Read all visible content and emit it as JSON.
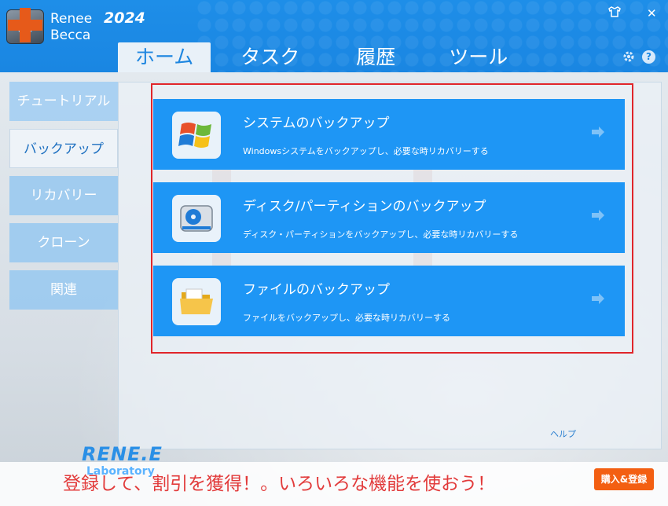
{
  "app": {
    "name_line1": "Renee",
    "name_line2": "Becca",
    "year": "2024"
  },
  "window_controls": {
    "skin_icon": "tshirt-icon",
    "close_label": "✕"
  },
  "tabs": [
    {
      "label": "ホーム",
      "active": true
    },
    {
      "label": "タスク",
      "active": false
    },
    {
      "label": "履歴",
      "active": false
    },
    {
      "label": "ツール",
      "active": false
    }
  ],
  "header_icons": {
    "settings": "gear-icon",
    "help": "?"
  },
  "sidebar": {
    "items": [
      {
        "label": "チュートリアル",
        "active": false
      },
      {
        "label": "バックアップ",
        "active": true
      },
      {
        "label": "リカバリー",
        "active": false
      },
      {
        "label": "クローン",
        "active": false
      },
      {
        "label": "関連",
        "active": false
      }
    ]
  },
  "cards": [
    {
      "icon": "windows-logo-icon",
      "title": "システムのバックアップ",
      "desc": "Windowsシステムをバックアップし、必要な時リカバリーする"
    },
    {
      "icon": "disk-drive-icon",
      "title": "ディスク/パーティションのバックアップ",
      "desc": "ディスク・パーティションをバックアップし、必要な時リカバリーする"
    },
    {
      "icon": "folder-icon",
      "title": "ファイルのバックアップ",
      "desc": "ファイルをバックアップし、必要な時リカバリーする"
    }
  ],
  "help_link": "ヘルプ",
  "banner": {
    "brand": "RENE.E",
    "brand_sub": "Laboratory",
    "promo": "登録して、割引を獲得！。いろいろな機能を使おう！",
    "buy_label": "購入&登録"
  },
  "colors": {
    "header_blue": "#1a86e2",
    "card_blue": "#1e96f5",
    "highlight_red": "#e0252a",
    "buy_orange": "#f35f12"
  }
}
